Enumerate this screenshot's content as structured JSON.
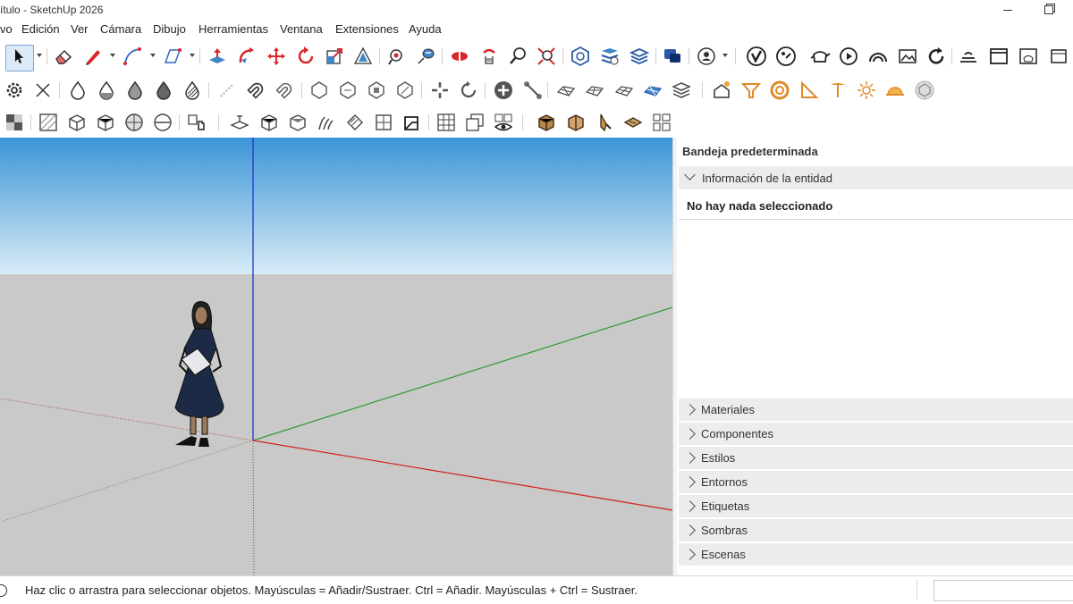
{
  "window": {
    "title": "ítulo - SketchUp 2026"
  },
  "menu": [
    "vo",
    "Edición",
    "Ver",
    "Cámara",
    "Dibujo",
    "Herramientas",
    "Ventana",
    "Extensiones",
    "Ayuda"
  ],
  "tray": {
    "title": "Bandeja predeterminada",
    "entity_info": {
      "header": "Información de la entidad",
      "message": "No hay nada seleccionado"
    },
    "panels": [
      "Materiales",
      "Componentes",
      "Estilos",
      "Entornos",
      "Etiquetas",
      "Sombras",
      "Escenas"
    ]
  },
  "status": {
    "text": "Haz clic o arrastra para seleccionar objetos. Mayúsculas = Añadir/Sustraer. Ctrl = Añadir. Mayúsculas + Ctrl = Sustraer."
  },
  "colors": {
    "sky_top": "#3b95d8",
    "sky_bottom": "#d8ecf7",
    "ground": "#c9c9c9",
    "axis_red": "#d42020",
    "axis_green": "#2f9b2f",
    "axis_blue": "#2233cc",
    "accent_red": "#d9262a"
  },
  "icons": {
    "toolbar1": [
      "select-arrow-icon",
      "eraser-icon",
      "pencil-line-icon",
      "arc-icon",
      "rectangle-icon",
      "push-pull-icon",
      "follow-me-icon",
      "move-icon",
      "rotate-icon",
      "scale-icon",
      "offset-icon",
      "tape-measure-icon",
      "text-label-icon",
      "section-plane-icon",
      "orbit-icon",
      "pan-icon",
      "zoom-icon",
      "zoom-extents-icon",
      "warehouse-icon",
      "extension-warehouse-icon",
      "layout-icon",
      "chat-icon",
      "profile-icon",
      "trimble-icon",
      "style-builder-icon",
      "teapot-icon",
      "camera-teapot-icon",
      "rainbow-icon",
      "photo-icon",
      "refresh-icon",
      "console-icon",
      "window-icon",
      "teapot-window-icon",
      "window-small-icon"
    ],
    "toolbar2": [
      "gear-icon",
      "close-icon",
      "drop-outline-icon",
      "drop-half-icon",
      "drop-fill-icon",
      "drop-dark-icon",
      "drop-pattern-icon",
      "dotted-icon",
      "magnet-icon",
      "magnet-broken-icon",
      "hexagon-a-icon",
      "hexagon-b-icon",
      "hexagon-c-icon",
      "hexagon-d-icon",
      "explode-icon",
      "recycle-icon",
      "add-circle-icon",
      "connect-icon",
      "terrain-a-icon",
      "terrain-b-icon",
      "terrain-c-icon",
      "terrain-d-icon",
      "stack-icon",
      "solar-house-icon",
      "funnel-icon",
      "ring-icon",
      "protractor-icon",
      "lamp-icon",
      "sun-burst-icon",
      "hardhat-icon",
      "hexagon-grey-icon"
    ],
    "toolbar3": [
      "model-info-icon",
      "xray-icon",
      "wireframe-icon",
      "hidden-line-icon",
      "shaded-icon",
      "shaded-texture-icon",
      "monochrome-icon",
      "component-hand-icon",
      "camera-icon",
      "box-iso-icon",
      "box-top-icon",
      "box-front-icon",
      "box-right-icon",
      "box-back-icon",
      "box-left-icon",
      "section-grid-icon",
      "section-cut-icon",
      "section-fill-icon",
      "eye-icon",
      "box-brown-a-icon",
      "box-brown-b-icon",
      "knife-icon",
      "chair-icon",
      "grid-blocks-icon"
    ]
  }
}
